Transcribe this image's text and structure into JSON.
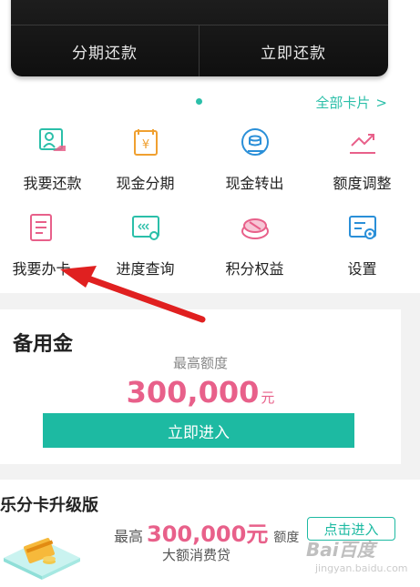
{
  "top_card": {
    "installment_repay": "分期还款",
    "repay_now": "立即还款"
  },
  "indicator": {
    "all_cards": "全部卡片",
    "chevron_icon": "chevron-right-icon",
    "accent_color": "#2bbfa9"
  },
  "grid": {
    "items": [
      {
        "label": "我要还款",
        "icon": "repay-icon"
      },
      {
        "label": "现金分期",
        "icon": "cash-installment-icon"
      },
      {
        "label": "现金转出",
        "icon": "cash-transfer-icon"
      },
      {
        "label": "额度调整",
        "icon": "limit-adjust-icon"
      },
      {
        "label": "我要办卡",
        "icon": "apply-card-icon"
      },
      {
        "label": "进度查询",
        "icon": "progress-query-icon"
      },
      {
        "label": "积分权益",
        "icon": "points-benefits-icon"
      },
      {
        "label": "设置",
        "icon": "settings-icon"
      }
    ]
  },
  "fund": {
    "title": "备用金",
    "subtitle": "最高额度",
    "amount": "300,000",
    "unit": "元",
    "button": "立即进入",
    "amount_color": "#e8608a",
    "button_color": "#1dbaa2"
  },
  "lefen": {
    "title": "乐分卡升级版",
    "prefix": "最高",
    "amount": "300,000元",
    "suffix": "额度",
    "desc": "大额消费贷",
    "button": "点击进入"
  },
  "watermark": {
    "main": "Bai百度",
    "sub": "jingyan.baidu.com"
  }
}
